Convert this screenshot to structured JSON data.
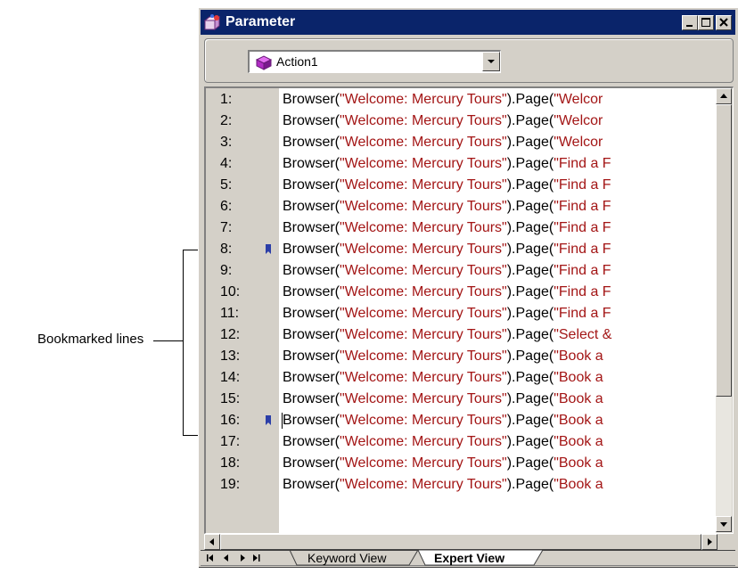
{
  "window": {
    "title": "Parameter",
    "action_select": {
      "value": "Action1"
    }
  },
  "callout": {
    "label": "Bookmarked lines"
  },
  "editor": {
    "lines": [
      {
        "num": "1:",
        "pre": "Browser(",
        "s1": "\"Welcome: Mercury Tours\"",
        "mid": ").Page(",
        "s2": "\"Welcor",
        "bookmark": false
      },
      {
        "num": "2:",
        "pre": "Browser(",
        "s1": "\"Welcome: Mercury Tours\"",
        "mid": ").Page(",
        "s2": "\"Welcor",
        "bookmark": false
      },
      {
        "num": "3:",
        "pre": "Browser(",
        "s1": "\"Welcome: Mercury Tours\"",
        "mid": ").Page(",
        "s2": "\"Welcor",
        "bookmark": false
      },
      {
        "num": "4:",
        "pre": "Browser(",
        "s1": "\"Welcome: Mercury Tours\"",
        "mid": ").Page(",
        "s2": "\"Find a F",
        "bookmark": false
      },
      {
        "num": "5:",
        "pre": "Browser(",
        "s1": "\"Welcome: Mercury Tours\"",
        "mid": ").Page(",
        "s2": "\"Find a F",
        "bookmark": false
      },
      {
        "num": "6:",
        "pre": "Browser(",
        "s1": "\"Welcome: Mercury Tours\"",
        "mid": ").Page(",
        "s2": "\"Find a F",
        "bookmark": false
      },
      {
        "num": "7:",
        "pre": "Browser(",
        "s1": "\"Welcome: Mercury Tours\"",
        "mid": ").Page(",
        "s2": "\"Find a F",
        "bookmark": false
      },
      {
        "num": "8:",
        "pre": "Browser(",
        "s1": "\"Welcome: Mercury Tours\"",
        "mid": ").Page(",
        "s2": "\"Find a F",
        "bookmark": true
      },
      {
        "num": "9:",
        "pre": "Browser(",
        "s1": "\"Welcome: Mercury Tours\"",
        "mid": ").Page(",
        "s2": "\"Find a F",
        "bookmark": false
      },
      {
        "num": "10:",
        "pre": "Browser(",
        "s1": "\"Welcome: Mercury Tours\"",
        "mid": ").Page(",
        "s2": "\"Find a F",
        "bookmark": false
      },
      {
        "num": "11:",
        "pre": "Browser(",
        "s1": "\"Welcome: Mercury Tours\"",
        "mid": ").Page(",
        "s2": "\"Find a F",
        "bookmark": false
      },
      {
        "num": "12:",
        "pre": "Browser(",
        "s1": "\"Welcome: Mercury Tours\"",
        "mid": ").Page(",
        "s2": "\"Select &",
        "bookmark": false
      },
      {
        "num": "13:",
        "pre": "Browser(",
        "s1": "\"Welcome: Mercury Tours\"",
        "mid": ").Page(",
        "s2": "\"Book a",
        "bookmark": false
      },
      {
        "num": "14:",
        "pre": "Browser(",
        "s1": "\"Welcome: Mercury Tours\"",
        "mid": ").Page(",
        "s2": "\"Book a",
        "bookmark": false
      },
      {
        "num": "15:",
        "pre": "Browser(",
        "s1": "\"Welcome: Mercury Tours\"",
        "mid": ").Page(",
        "s2": "\"Book a",
        "bookmark": false
      },
      {
        "num": "16:",
        "pre": "Browser(",
        "s1": "\"Welcome: Mercury Tours\"",
        "mid": ").Page(",
        "s2": "\"Book a",
        "bookmark": true
      },
      {
        "num": "17:",
        "pre": "Browser(",
        "s1": "\"Welcome: Mercury Tours\"",
        "mid": ").Page(",
        "s2": "\"Book a",
        "bookmark": false
      },
      {
        "num": "18:",
        "pre": "Browser(",
        "s1": "\"Welcome: Mercury Tours\"",
        "mid": ").Page(",
        "s2": "\"Book a",
        "bookmark": false
      },
      {
        "num": "19:",
        "pre": "Browser(",
        "s1": "\"Welcome: Mercury Tours\"",
        "mid": ").Page(",
        "s2": "\"Book a",
        "bookmark": false
      }
    ]
  },
  "tabs": [
    {
      "label": "Keyword View",
      "active": false
    },
    {
      "label": "Expert View",
      "active": true
    }
  ],
  "icons": {
    "window": "parameter-app-icon",
    "action": "action-cube-icon",
    "bookmark": "bookmark-icon",
    "minimize": "minimize-icon",
    "maximize": "maximize-icon",
    "close": "close-icon"
  },
  "colors": {
    "titlebar": "#0a246a",
    "string_literal": "#a31515",
    "bookmark": "#2b3ea8",
    "action_cube": "#b02cc4"
  }
}
